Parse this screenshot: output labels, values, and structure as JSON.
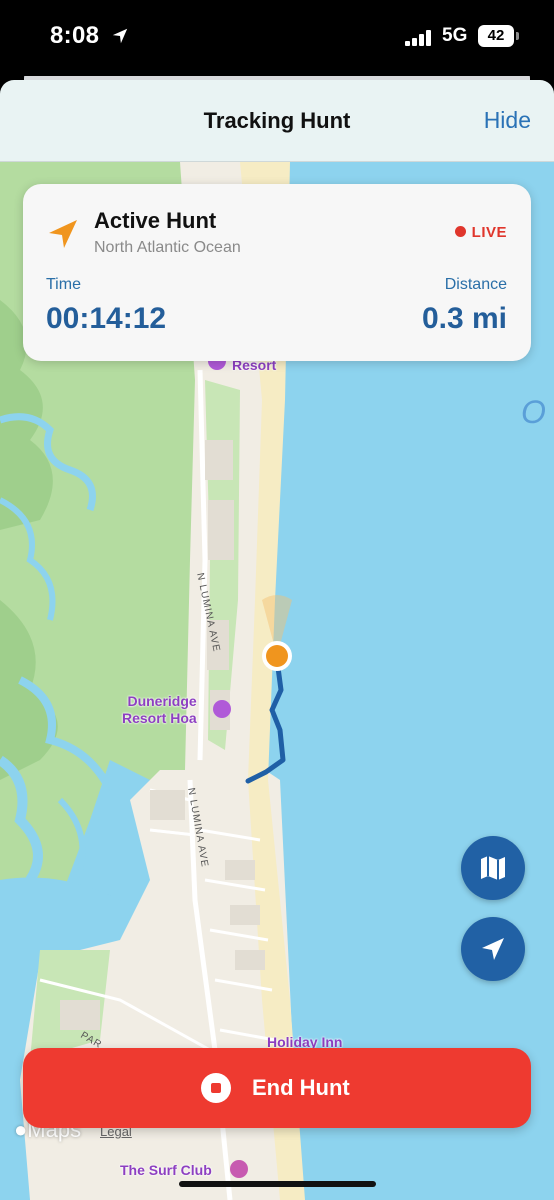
{
  "status_bar": {
    "time": "8:08",
    "network": "5G",
    "battery": "42"
  },
  "nav": {
    "title": "Tracking Hunt",
    "hide_label": "Hide"
  },
  "card": {
    "title": "Active Hunt",
    "location": "North Atlantic Ocean",
    "live_label": "LIVE",
    "time_label": "Time",
    "time_value": "00:14:12",
    "distance_label": "Distance",
    "distance_value": "0.3 mi",
    "icon": "location-arrow-icon"
  },
  "map": {
    "labels": {
      "resort_top": "Resort",
      "duneridge_line1": "Duneridge",
      "duneridge_line2": "Resort Hoa",
      "road_upper": "N LUMINA AVE",
      "road_lower": "N LUMINA AVE",
      "road_par": "PAR",
      "holiday_inn": "Holiday Inn",
      "surf_club": "The Surf Club",
      "ocean_letter": "O"
    },
    "brand": "Maps",
    "legal": "Legal"
  },
  "buttons": {
    "map_style_icon": "map-icon",
    "locate_icon": "location-arrow-icon",
    "end_hunt": "End Hunt"
  },
  "colors": {
    "accent_blue": "#2161a5",
    "live_red": "#e0362c",
    "end_red": "#ee3a30",
    "hunter_orange": "#f0951e",
    "track_blue": "#1f5fa6"
  }
}
